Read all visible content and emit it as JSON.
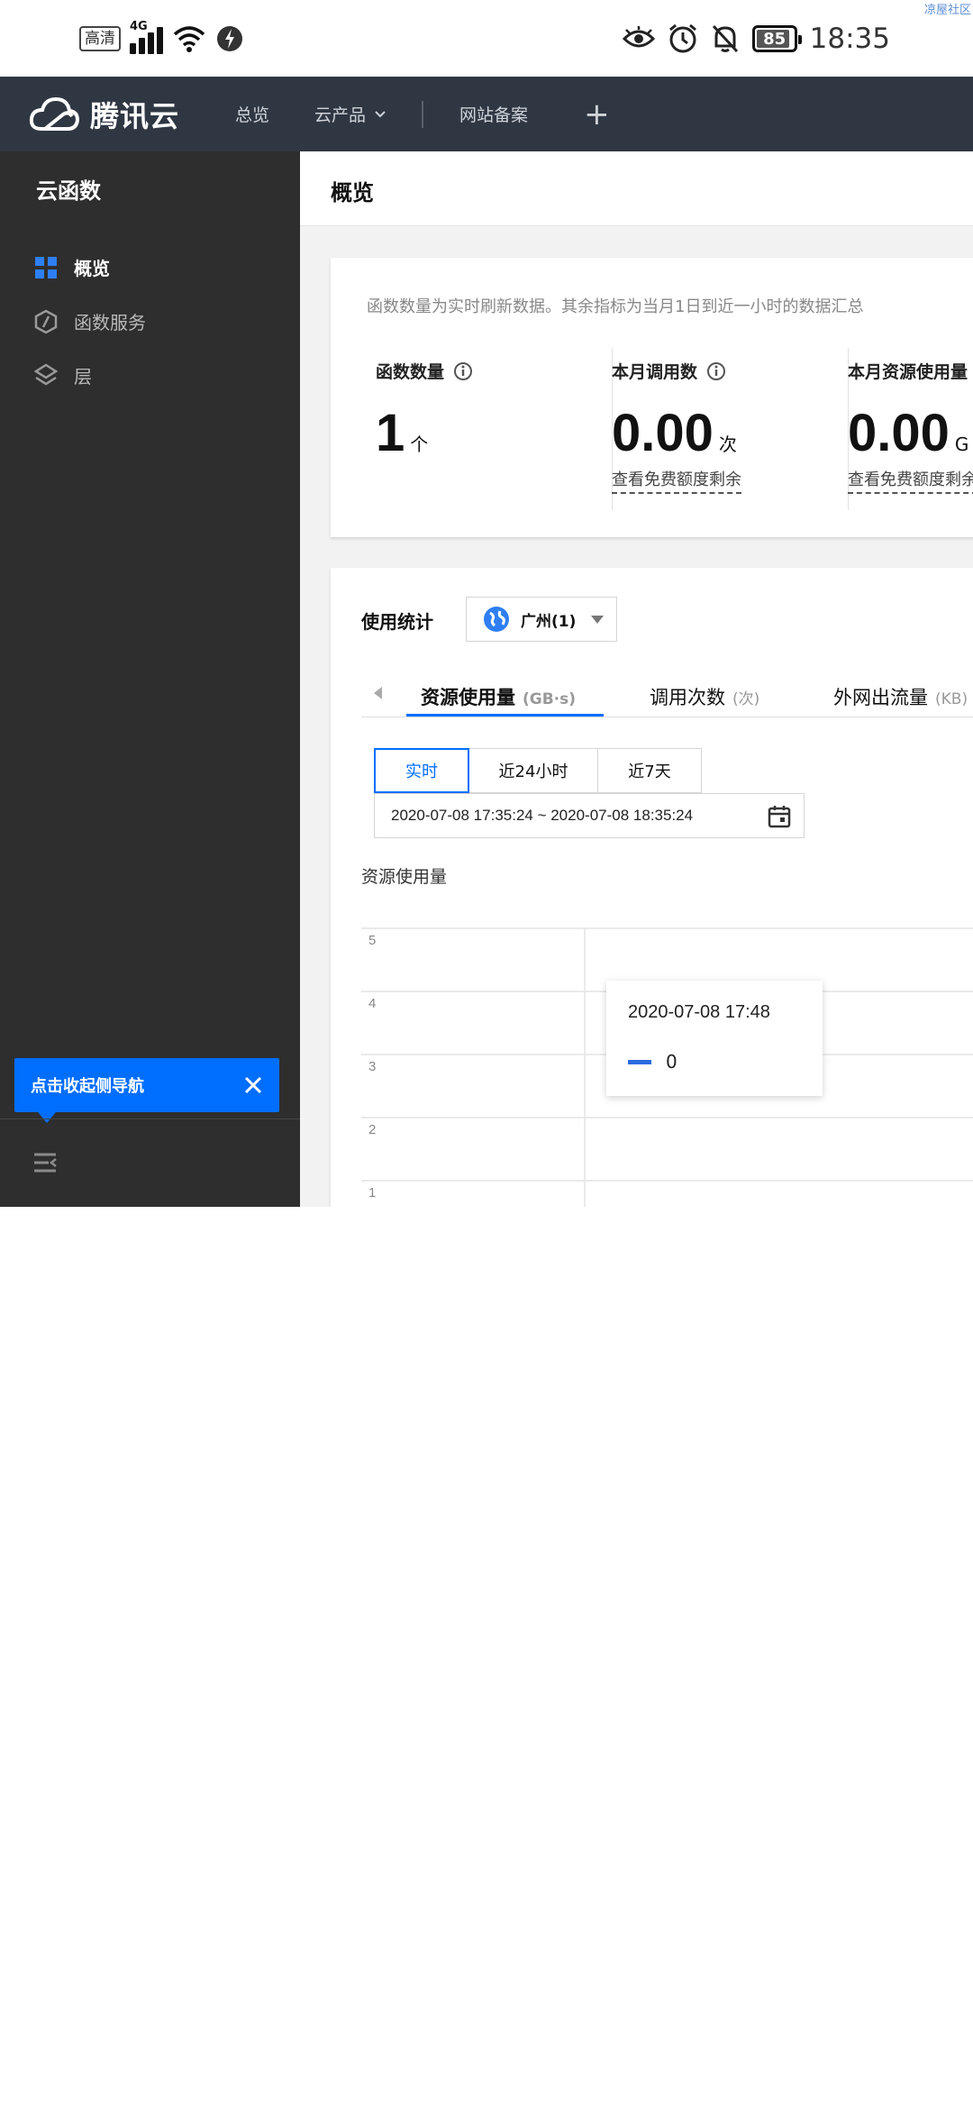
{
  "status_bar": {
    "hd_label": "高清",
    "network": "4G",
    "battery": "85",
    "time": "18:35",
    "corner_tag": "凉屋社区",
    "icons": [
      "signal-icon",
      "wifi-icon",
      "vpn-icon",
      "eye-icon",
      "alarm-icon",
      "mute-icon",
      "battery-icon"
    ]
  },
  "topnav": {
    "brand": "腾讯云",
    "items": [
      "总览",
      "云产品",
      "网站备案"
    ],
    "plus": "+"
  },
  "sidebar": {
    "title": "云函数",
    "items": [
      {
        "label": "概览",
        "icon": "grid-icon",
        "active": true
      },
      {
        "label": "函数服务",
        "icon": "function-icon",
        "active": false
      },
      {
        "label": "层",
        "icon": "layers-icon",
        "active": false
      }
    ],
    "collapse_tip": "点击收起侧导航"
  },
  "page": {
    "title": "概览",
    "note": "函数数量为实时刷新数据。其余指标为当月1日到近一小时的数据汇总",
    "metrics": [
      {
        "label": "函数数量",
        "value": "1",
        "unit": "个",
        "link": ""
      },
      {
        "label": "本月调用数",
        "value": "0.00",
        "unit": "次",
        "link": "查看免费额度剩余"
      },
      {
        "label": "本月资源使用量",
        "value": "0.00",
        "unit": "G",
        "link": "查看免费额度剩余"
      }
    ]
  },
  "usage": {
    "label": "使用统计",
    "region": "广州(1)",
    "tabs": [
      {
        "label": "资源使用量",
        "unit": "(GB·s)"
      },
      {
        "label": "调用次数",
        "unit": "(次)"
      },
      {
        "label": "外网出流量",
        "unit": "(KB)"
      }
    ],
    "active_tab": 0,
    "time_buttons": [
      "实时",
      "近24小时",
      "近7天"
    ],
    "active_time": 0,
    "range": "2020-07-08 17:35:24 ~ 2020-07-08 18:35:24",
    "chart_title": "资源使用量",
    "tooltip": {
      "date": "2020-07-08 17:48",
      "value": "0"
    }
  },
  "chart_data": {
    "type": "line",
    "title": "资源使用量",
    "ylim": [
      0,
      5
    ],
    "y_ticks": [
      "5",
      "4",
      "3",
      "2",
      "1"
    ],
    "grid": true,
    "series": [
      {
        "x": [
          "2020-07-08 17:48"
        ],
        "values": [
          0
        ]
      }
    ]
  },
  "colors": {
    "accent": "#006eff",
    "nav_bg": "#2f3743",
    "sidebar_bg": "#2e2e2e",
    "series": "#2d6be0"
  }
}
